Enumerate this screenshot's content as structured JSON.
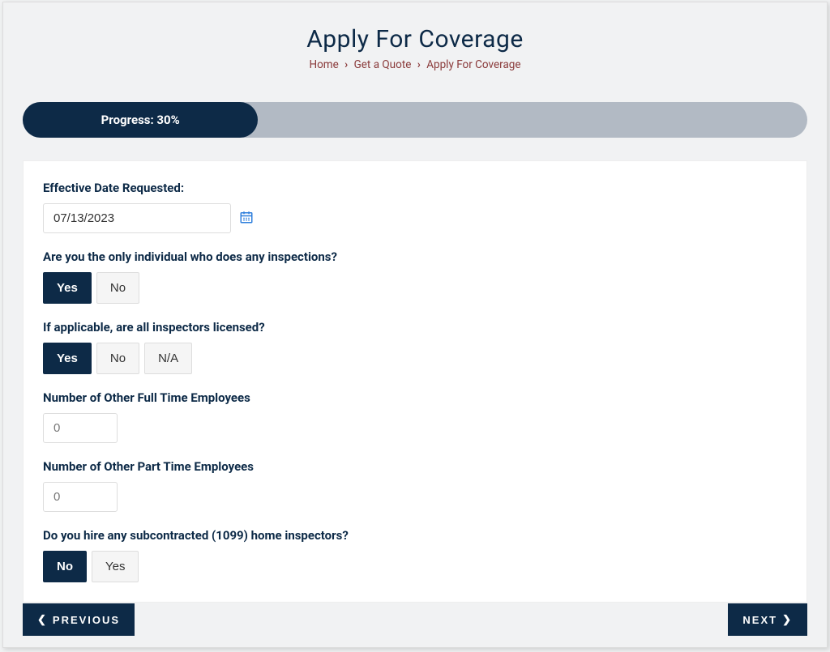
{
  "header": {
    "title": "Apply For Coverage",
    "breadcrumb": {
      "item0": "Home",
      "item1": "Get a Quote",
      "item2": "Apply For Coverage"
    }
  },
  "progress": {
    "label": "Progress: 30%",
    "percent": 30
  },
  "form": {
    "effectiveDate": {
      "label": "Effective Date Requested:",
      "value": "07/13/2023"
    },
    "onlyIndividual": {
      "label": "Are you the only individual who does any inspections?",
      "yes": "Yes",
      "no": "No",
      "selected": "Yes"
    },
    "allLicensed": {
      "label": "If applicable, are all inspectors licensed?",
      "yes": "Yes",
      "no": "No",
      "na": "N/A",
      "selected": "Yes"
    },
    "fullTime": {
      "label": "Number of Other Full Time Employees",
      "value": "0"
    },
    "partTime": {
      "label": "Number of Other Part Time Employees",
      "value": "0"
    },
    "subcontracted": {
      "label": "Do you hire any subcontracted (1099) home inspectors?",
      "yes": "Yes",
      "no": "No",
      "selected": "No"
    }
  },
  "nav": {
    "previous": "PREVIOUS",
    "next": "NEXT"
  }
}
